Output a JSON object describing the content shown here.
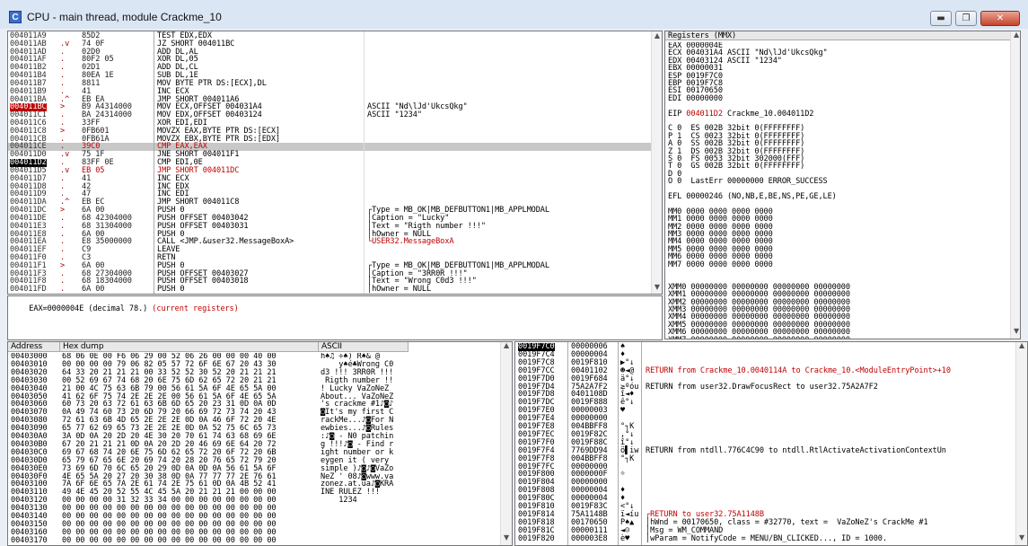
{
  "window": {
    "title": "CPU - main thread, module Crackme_10",
    "icon_letter": "C",
    "minimize": "▬",
    "maximize": "❐",
    "close": "✕"
  },
  "disasm": [
    {
      "addr": "004011A9",
      "mark": "",
      "hex": "85D2",
      "dis": "TEST EDX,EDX",
      "com": "",
      "cls": ""
    },
    {
      "addr": "004011AB",
      "mark": ".v",
      "hex": "74 0F",
      "dis": "JZ SHORT 004011BC",
      "com": "",
      "cls": ""
    },
    {
      "addr": "004011AD",
      "mark": ".",
      "hex": "02D0",
      "dis": "ADD DL,AL",
      "com": "",
      "cls": ""
    },
    {
      "addr": "004011AF",
      "mark": ".",
      "hex": "80F2 05",
      "dis": "XOR DL,05",
      "com": "",
      "cls": ""
    },
    {
      "addr": "004011B2",
      "mark": ".",
      "hex": "02D1",
      "dis": "ADD DL,CL",
      "com": "",
      "cls": ""
    },
    {
      "addr": "004011B4",
      "mark": ".",
      "hex": "80EA 1E",
      "dis": "SUB DL,1E",
      "com": "",
      "cls": ""
    },
    {
      "addr": "004011B7",
      "mark": ".",
      "hex": "8811",
      "dis": "MOV BYTE PTR DS:[ECX],DL",
      "com": "",
      "cls": ""
    },
    {
      "addr": "004011B9",
      "mark": ".",
      "hex": "41",
      "dis": "INC ECX",
      "com": "",
      "cls": ""
    },
    {
      "addr": "004011BA",
      "mark": ".^",
      "hex": "EB EA",
      "dis": "JMP SHORT 004011A6",
      "com": "",
      "cls": ""
    },
    {
      "addr": "004011BC",
      "mark": ">",
      "hex": "B9 A4314000",
      "dis": "MOV ECX,OFFSET 004031A4",
      "com": "ASCII \"Nd\\lJd'UkcsQkg\"",
      "cls": "bp"
    },
    {
      "addr": "004011C1",
      "mark": ".",
      "hex": "BA 24314000",
      "dis": "MOV EDX,OFFSET 00403124",
      "com": "ASCII \"1234\"",
      "cls": ""
    },
    {
      "addr": "004011C6",
      "mark": ".",
      "hex": "33FF",
      "dis": "XOR EDI,EDI",
      "com": "",
      "cls": ""
    },
    {
      "addr": "004011C8",
      "mark": ">",
      "hex": "0FB601",
      "dis": "MOVZX EAX,BYTE PTR DS:[ECX]",
      "com": "",
      "cls": ""
    },
    {
      "addr": "004011CB",
      "mark": ".",
      "hex": "0FB61A",
      "dis": "MOVZX EBX,BYTE PTR DS:[EDX]",
      "com": "",
      "cls": ""
    },
    {
      "addr": "004011CE",
      "mark": ".",
      "hex": "39C0",
      "dis": "CMP EAX,EAX",
      "com": "",
      "cls": "sel redtxt"
    },
    {
      "addr": "004011D0",
      "mark": ".v",
      "hex": "75 1F",
      "dis": "JNE SHORT 004011F1",
      "com": "",
      "cls": ""
    },
    {
      "addr": "004011D2",
      "mark": ".",
      "hex": "83FF 0E",
      "dis": "CMP EDI,0E",
      "com": "",
      "cls": "eip"
    },
    {
      "addr": "004011D5",
      "mark": ".v",
      "hex": "EB 05",
      "dis": "JMP SHORT 004011DC",
      "com": "",
      "cls": "redtxt"
    },
    {
      "addr": "004011D7",
      "mark": ".",
      "hex": "41",
      "dis": "INC ECX",
      "com": "",
      "cls": ""
    },
    {
      "addr": "004011D8",
      "mark": ".",
      "hex": "42",
      "dis": "INC EDX",
      "com": "",
      "cls": ""
    },
    {
      "addr": "004011D9",
      "mark": ".",
      "hex": "47",
      "dis": "INC EDI",
      "com": "",
      "cls": ""
    },
    {
      "addr": "004011DA",
      "mark": ".^",
      "hex": "EB EC",
      "dis": "JMP SHORT 004011C8",
      "com": "",
      "cls": ""
    },
    {
      "addr": "004011DC",
      "mark": ">",
      "hex": "6A 00",
      "dis": "PUSH 0",
      "com": "┌Type = MB_OK|MB_DEFBUTTON1|MB_APPLMODAL",
      "cls": ""
    },
    {
      "addr": "004011DE",
      "mark": ".",
      "hex": "68 42304000",
      "dis": "PUSH OFFSET 00403042",
      "com": "│Caption = \"Lucky\"",
      "cls": ""
    },
    {
      "addr": "004011E3",
      "mark": ".",
      "hex": "68 31304000",
      "dis": "PUSH OFFSET 00403031",
      "com": "│Text = \"Rigth number !!!\"",
      "cls": ""
    },
    {
      "addr": "004011E8",
      "mark": ".",
      "hex": "6A 00",
      "dis": "PUSH 0",
      "com": "│hOwner = NULL",
      "cls": ""
    },
    {
      "addr": "004011EA",
      "mark": ".",
      "hex": "E8 35000000",
      "dis": "CALL <JMP.&user32.MessageBoxA>",
      "com": "└USER32.MessageBoxA",
      "cls": "redcom"
    },
    {
      "addr": "004011EF",
      "mark": ".",
      "hex": "C9",
      "dis": "LEAVE",
      "com": "",
      "cls": ""
    },
    {
      "addr": "004011F0",
      "mark": ".",
      "hex": "C3",
      "dis": "RETN",
      "com": "",
      "cls": ""
    },
    {
      "addr": "004011F1",
      "mark": ">",
      "hex": "6A 00",
      "dis": "PUSH 0",
      "com": "┌Type = MB_OK|MB_DEFBUTTON1|MB_APPLMODAL",
      "cls": ""
    },
    {
      "addr": "004011F3",
      "mark": ".",
      "hex": "68 27304000",
      "dis": "PUSH OFFSET 00403027",
      "com": "│Caption = \"3RR0R !!!\"",
      "cls": ""
    },
    {
      "addr": "004011F8",
      "mark": ".",
      "hex": "68 18304000",
      "dis": "PUSH OFFSET 00403018",
      "com": "│Text = \"Wrong C0d3 !!!\"",
      "cls": ""
    },
    {
      "addr": "004011FD",
      "mark": ".",
      "hex": "6A 00",
      "dis": "PUSH 0",
      "com": "│hOwner = NULL",
      "cls": ""
    }
  ],
  "info_line": "EAX=0000004E (decimal 78.)",
  "info_red": "(current registers)",
  "registers": {
    "header": "Registers (MMX)",
    "lines": [
      {
        "t": "EAX 0000004E",
        "r": ""
      },
      {
        "t": "ECX 004031A4 ASCII \"Nd\\lJd'UkcsQkg\"",
        "r": ""
      },
      {
        "t": "EDX 00403124 ASCII \"1234\"",
        "r": ""
      },
      {
        "t": "EBX 00000031",
        "r": ""
      },
      {
        "t": "ESP 0019F7C0",
        "r": ""
      },
      {
        "t": "EBP 0019F7C8",
        "r": ""
      },
      {
        "t": "ESI 00170650",
        "r": ""
      },
      {
        "t": "EDI 00000000",
        "r": ""
      },
      {
        "t": "",
        "r": ""
      },
      {
        "t": "EIP ",
        "r": "004011D2",
        "s": " Crackme_10.004011D2"
      },
      {
        "t": "",
        "r": ""
      },
      {
        "t": "C 0  ES 002B 32bit 0(FFFFFFFF)",
        "r": ""
      },
      {
        "t": "P 1  CS 0023 32bit 0(FFFFFFFF)",
        "r": ""
      },
      {
        "t": "A 0  SS 002B 32bit 0(FFFFFFFF)",
        "r": ""
      },
      {
        "t": "Z 1  DS 002B 32bit 0(FFFFFFFF)",
        "r": ""
      },
      {
        "t": "S 0  FS 0053 32bit 302000(FFF)",
        "r": ""
      },
      {
        "t": "T 0  GS 002B 32bit 0(FFFFFFFF)",
        "r": ""
      },
      {
        "t": "D 0",
        "r": ""
      },
      {
        "t": "O 0  LastErr 00000000 ERROR_SUCCESS",
        "r": ""
      },
      {
        "t": "",
        "r": ""
      },
      {
        "t": "EFL 00000246 (NO,NB,E,BE,NS,PE,GE,LE)",
        "r": ""
      },
      {
        "t": "",
        "r": ""
      },
      {
        "t": "MM0 0000 0000 0000 0000",
        "r": ""
      },
      {
        "t": "MM1 0000 0000 0000 0000",
        "r": ""
      },
      {
        "t": "MM2 0000 0000 0000 0000",
        "r": ""
      },
      {
        "t": "MM3 0000 0000 0000 0000",
        "r": ""
      },
      {
        "t": "MM4 0000 0000 0000 0000",
        "r": ""
      },
      {
        "t": "MM5 0000 0000 0000 0000",
        "r": ""
      },
      {
        "t": "MM6 0000 0000 0000 0000",
        "r": ""
      },
      {
        "t": "MM7 0000 0000 0000 0000",
        "r": ""
      },
      {
        "t": "",
        "r": ""
      },
      {
        "t": "",
        "r": ""
      },
      {
        "t": "XMM0 00000000 00000000 00000000 00000000",
        "r": ""
      },
      {
        "t": "XMM1 00000000 00000000 00000000 00000000",
        "r": ""
      },
      {
        "t": "XMM2 00000000 00000000 00000000 00000000",
        "r": ""
      },
      {
        "t": "XMM3 00000000 00000000 00000000 00000000",
        "r": ""
      },
      {
        "t": "XMM4 00000000 00000000 00000000 00000000",
        "r": ""
      },
      {
        "t": "XMM5 00000000 00000000 00000000 00000000",
        "r": ""
      },
      {
        "t": "XMM6 00000000 00000000 00000000 00000000",
        "r": ""
      },
      {
        "t": "XMM7 00000000 00000000 00000000 00000000",
        "r": ""
      }
    ]
  },
  "dump": {
    "col_address": "Address",
    "col_hex": "Hex dump",
    "col_ascii": "ASCII",
    "rows": [
      {
        "a": "00403000",
        "h": "68 06 0E 00 F6 06 29 00 52 06 26 00 00 00 40 00",
        "s": "h♠♫ ÷♠) R♠& @"
      },
      {
        "a": "00403010",
        "h": "00 00 00 00 79 06 82 05 57 72 6F 6E 67 20 43 30",
        "s": "    y♠é♣Wrong C0"
      },
      {
        "a": "00403020",
        "h": "64 33 20 21 21 21 00 33 52 52 30 52 20 21 21 21",
        "s": "d3 !!! 3RR0R !!!"
      },
      {
        "a": "00403030",
        "h": "00 52 69 67 74 68 20 6E 75 6D 62 65 72 20 21 21",
        "s": " Rigth number !!"
      },
      {
        "a": "00403040",
        "h": "21 00 4C 75 63 6B 79 00 56 61 5A 6F 4E 65 5A 00",
        "s": "! Lucky VaZoNeZ"
      },
      {
        "a": "00403050",
        "h": "41 62 6F 75 74 2E 2E 2E 00 56 61 5A 6F 4E 65 5A",
        "s": "About... VaZoNeZ"
      },
      {
        "a": "00403060",
        "h": "60 73 20 63 72 61 63 6B 6D 65 20 23 31 0D 0A 0D",
        "s": "'s crackme #1♪◙♪"
      },
      {
        "a": "00403070",
        "h": "0A 49 74 60 73 20 6D 79 20 66 69 72 73 74 20 43",
        "s": "◙It's my first C"
      },
      {
        "a": "00403080",
        "h": "72 61 63 6B 4D 65 2E 2E 2E 0D 0A 46 6F 72 20 4E",
        "s": "rackMe...♪◙For N"
      },
      {
        "a": "00403090",
        "h": "65 77 62 69 65 73 2E 2E 2E 0D 0A 52 75 6C 65 73",
        "s": "ewbies...♪◙Rules"
      },
      {
        "a": "004030A0",
        "h": "3A 0D 0A 20 2D 20 4E 30 20 70 61 74 63 68 69 6E",
        "s": ":♪◙ - N0 patchin"
      },
      {
        "a": "004030B0",
        "h": "67 20 21 21 21 0D 0A 20 2D 20 46 69 6E 64 20 72",
        "s": "g !!!♪◙ - Find r"
      },
      {
        "a": "004030C0",
        "h": "69 67 68 74 20 6E 75 6D 62 65 72 20 6F 72 20 6B",
        "s": "ight number or k"
      },
      {
        "a": "004030D0",
        "h": "65 79 67 65 6E 20 69 74 20 28 20 76 65 72 79 20",
        "s": "eygen it ( very "
      },
      {
        "a": "004030E0",
        "h": "73 69 6D 70 6C 65 20 29 0D 0A 0D 0A 56 61 5A 6F",
        "s": "simple )♪◙♪◙VaZo"
      },
      {
        "a": "004030F0",
        "h": "4E 65 5A 20 27 20 30 38 0D 0A 77 77 77 2E 76 61",
        "s": "NeZ ' 08♪◙www.va"
      },
      {
        "a": "00403100",
        "h": "7A 6F 6E 65 7A 2E 61 74 2E 75 61 0D 0A 4B 52 41",
        "s": "zonez.at.ua♪◙KRA"
      },
      {
        "a": "00403110",
        "h": "49 4E 45 20 52 55 4C 45 5A 20 21 21 21 00 00 00",
        "s": "INE RULEZ !!!"
      },
      {
        "a": "00403120",
        "h": "00 00 00 00 31 32 33 34 00 00 00 00 00 00 00 00",
        "s": "    1234"
      },
      {
        "a": "00403130",
        "h": "00 00 00 00 00 00 00 00 00 00 00 00 00 00 00 00",
        "s": ""
      },
      {
        "a": "00403140",
        "h": "00 00 00 00 00 00 00 00 00 00 00 00 00 00 00 00",
        "s": ""
      },
      {
        "a": "00403150",
        "h": "00 00 00 00 00 00 00 00 00 00 00 00 00 00 00 00",
        "s": ""
      },
      {
        "a": "00403160",
        "h": "00 00 00 00 00 00 00 00 00 00 00 00 00 00 00 00",
        "s": ""
      },
      {
        "a": "00403170",
        "h": "00 00 00 00 00 00 00 00 00 00 00 00 00 00 00 00",
        "s": ""
      }
    ]
  },
  "stack": [
    {
      "a": "0019F7C0",
      "v": "00000006",
      "s": "♠",
      "c": "",
      "sel": true
    },
    {
      "a": "0019F7C4",
      "v": "00000004",
      "s": "♦",
      "c": ""
    },
    {
      "a": "0019F7C8",
      "v": "0019F810",
      "s": "▶°↓",
      "c": ""
    },
    {
      "a": "0019F7CC",
      "v": "00401102",
      "s": "☻◄@",
      "c": "RETURN from Crackme_10.0040114A to Crackme_10.<ModuleEntryPoint>+10",
      "red": true
    },
    {
      "a": "0019F7D0",
      "v": "0019F684",
      "s": "ä°↓",
      "c": ""
    },
    {
      "a": "0019F7D4",
      "v": "75A2A7F2",
      "s": "≥ºóu",
      "c": "RETURN from user32.DrawFocusRect to user32.75A2A7F2"
    },
    {
      "a": "0019F7D8",
      "v": "0401108D",
      "s": "î◄♦",
      "c": ""
    },
    {
      "a": "0019F7DC",
      "v": "0019F888",
      "s": "ê°↓",
      "c": ""
    },
    {
      "a": "0019F7E0",
      "v": "00000003",
      "s": "♥",
      "c": ""
    },
    {
      "a": "0019F7E4",
      "v": "00000000",
      "s": "",
      "c": ""
    },
    {
      "a": "0019F7E8",
      "v": "004BBFF8",
      "s": "°┐K",
      "c": ""
    },
    {
      "a": "0019F7EC",
      "v": "0019F82C",
      "s": ",°↓",
      "c": ""
    },
    {
      "a": "0019F7F0",
      "v": "0019F88C",
      "s": "î°↓",
      "c": ""
    },
    {
      "a": "0019F7F4",
      "v": "7769DD94",
      "s": "ö▌iw",
      "c": "RETURN from ntdll.776C4C90 to ntdll.RtlActivateActivationContextUn"
    },
    {
      "a": "0019F7F8",
      "v": "004BBFF8",
      "s": "°┐K",
      "c": ""
    },
    {
      "a": "0019F7FC",
      "v": "00000000",
      "s": "",
      "c": ""
    },
    {
      "a": "0019F800",
      "v": "0000000F",
      "s": "☼",
      "c": ""
    },
    {
      "a": "0019F804",
      "v": "00000000",
      "s": "",
      "c": ""
    },
    {
      "a": "0019F808",
      "v": "00000004",
      "s": "♦",
      "c": ""
    },
    {
      "a": "0019F80C",
      "v": "00000004",
      "s": "♦",
      "c": ""
    },
    {
      "a": "0019F810",
      "v": "0019F83C",
      "s": "<°↓",
      "c": ""
    },
    {
      "a": "0019F814",
      "v": "75A1148B",
      "s": "ï◄íu",
      "c": "┌RETURN to user32.75A1148B",
      "red": true
    },
    {
      "a": "0019F818",
      "v": "00170650",
      "s": "P♠▲",
      "c": "│hWnd = 00170650, class = #32770, text =  VaZoNeZ's CrackMe #1"
    },
    {
      "a": "0019F81C",
      "v": "00000111",
      "s": "◄☺",
      "c": "│Msg = WM_COMMAND"
    },
    {
      "a": "0019F820",
      "v": "000003E8",
      "s": "è♥",
      "c": "│wParam = NotifyCode = MENU/BN_CLICKED..., ID = 1000."
    }
  ]
}
